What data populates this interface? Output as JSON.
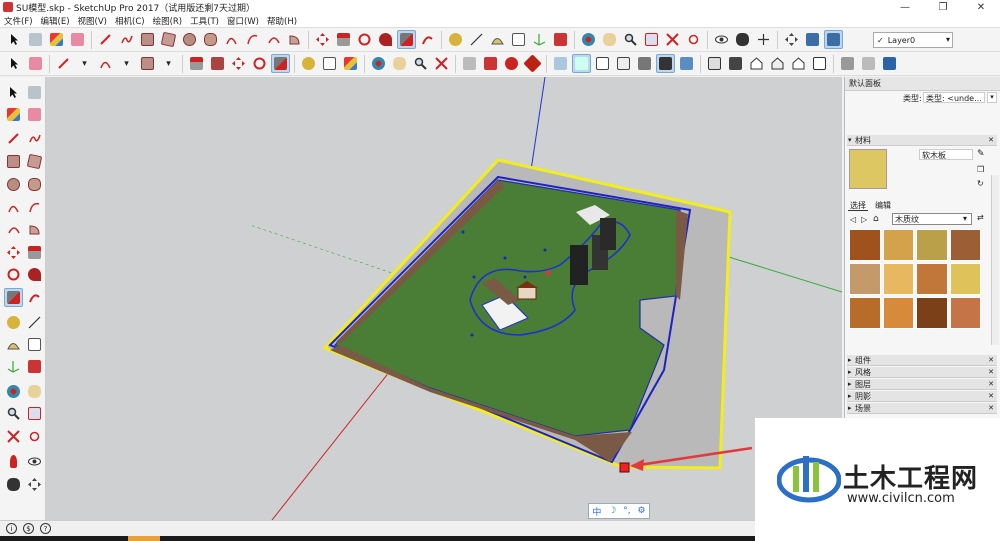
{
  "window": {
    "title": "SU模型.skp - SketchUp Pro 2017（试用版还剩7天过期）",
    "minimize": "—",
    "restore": "❐",
    "close": "✕"
  },
  "menu": [
    "文件(F)",
    "编辑(E)",
    "视图(V)",
    "相机(C)",
    "绘图(R)",
    "工具(T)",
    "窗口(W)",
    "帮助(H)"
  ],
  "layer_select": {
    "value": "Layer0",
    "check": "✓"
  },
  "tray": {
    "title": "默认面板",
    "type_label": "类型:",
    "type_value": "类型: <unde...",
    "materials_header": "材料",
    "material_name": "软木板",
    "tab_select": "选择",
    "tab_edit": "编辑",
    "library_value": "木质纹",
    "panels": [
      "组件",
      "风格",
      "图层",
      "阴影",
      "场景"
    ],
    "swatch_colors": [
      "#a0521e",
      "#d4a24a",
      "#bba04a",
      "#9c5e34",
      "#c59a6a",
      "#e7b860",
      "#c2773a",
      "#e0c25a",
      "#b86c2a",
      "#d68a3a",
      "#7c4018",
      "#c47446"
    ]
  },
  "ime": {
    "mode": "中",
    "moon": "☽",
    "punct": "°,",
    "gear": "⚙"
  },
  "watermark": {
    "name": "土木工程网",
    "url": "www.civilcn.com"
  }
}
